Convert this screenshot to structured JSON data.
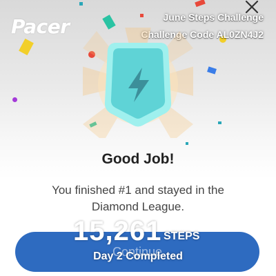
{
  "brand": {
    "logo_text": "Pacer"
  },
  "overlay": {
    "challenge_name": "June Steps Challenge",
    "challenge_code": "Challenge Code AL0ZN4J2",
    "steps_value": "15,261",
    "steps_unit": "STEPS",
    "day_status": "Day 2 Completed"
  },
  "dialog": {
    "title": "Good Job!",
    "message": "You finished #1 and stayed in the Diamond League.",
    "continue_label": "Continue",
    "close_icon": "close-icon",
    "badge_icon": "lightning-bolt-icon",
    "league_badge": "diamond-league-badge"
  },
  "colors": {
    "primary_button": "#2e6bc0",
    "badge_fill": "#5fd3d6",
    "badge_border": "#9ff0ee",
    "badge_glow": "#f6c27a"
  }
}
